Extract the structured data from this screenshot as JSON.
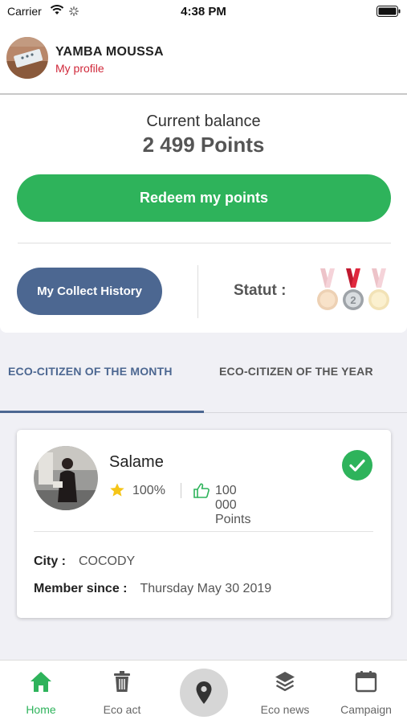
{
  "status_bar": {
    "carrier": "Carrier",
    "time": "4:38 PM"
  },
  "header": {
    "username": "YAMBA MOUSSA",
    "profile_link": "My profile"
  },
  "balance": {
    "label": "Current balance",
    "value": "2 499 Points",
    "redeem_label": "Redeem my points"
  },
  "actions": {
    "history_label": "My Collect History",
    "statut_label": "Statut :"
  },
  "tabs": [
    {
      "label": "ECO-CITIZEN OF THE MONTH",
      "active": true
    },
    {
      "label": "ECO-CITIZEN OF THE YEAR",
      "active": false
    }
  ],
  "citizen": {
    "name": "Salame",
    "rating": "100%",
    "points": "100 000 Points",
    "city_label": "City :",
    "city": "COCODY",
    "member_label": "Member since :",
    "member_since": "Thursday May 30 2019"
  },
  "tabbar": {
    "items": [
      {
        "label": "Home",
        "icon": "home-icon",
        "active": true
      },
      {
        "label": "Eco act",
        "icon": "trash-icon",
        "active": false
      },
      {
        "label": "",
        "icon": "map-pin-icon",
        "active": false
      },
      {
        "label": "Eco news",
        "icon": "layers-icon",
        "active": false
      },
      {
        "label": "Campaign",
        "icon": "calendar-icon",
        "active": false
      }
    ]
  },
  "colors": {
    "brand_green": "#2eb35b",
    "navy": "#4c6791",
    "profile_red": "#d0283a"
  }
}
